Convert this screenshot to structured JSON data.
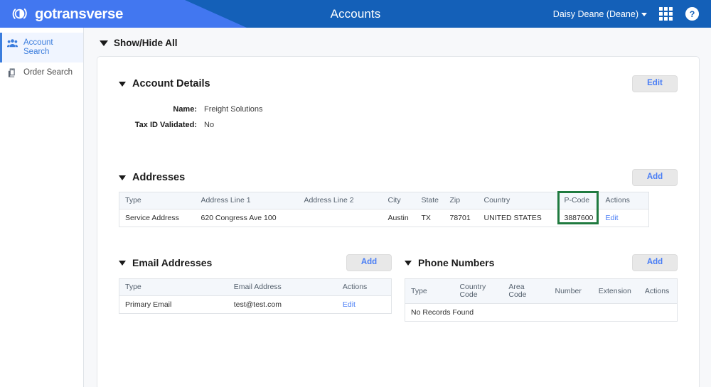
{
  "header": {
    "brand": "gotransverse",
    "brand_logo_icon": "gotransverse-circle-logo",
    "page_title": "Accounts",
    "user_menu": "Daisy Deane (Deane)",
    "apps_icon": "grid-apps-icon",
    "help_icon": "help-question-icon",
    "colors": {
      "light_blue": "#4277f0",
      "dark_blue": "#1460b8"
    }
  },
  "sidebar": {
    "items": [
      {
        "label": "Account Search",
        "icon": "people-group-icon",
        "active": true
      },
      {
        "label": "Order Search",
        "icon": "copy-documents-icon",
        "active": false
      }
    ]
  },
  "main": {
    "show_hide_all": "Show/Hide All",
    "account_details": {
      "title": "Account Details",
      "edit_label": "Edit",
      "fields": [
        {
          "label": "Name:",
          "value": "Freight Solutions"
        },
        {
          "label": "Tax ID Validated:",
          "value": "No"
        }
      ]
    },
    "addresses": {
      "title": "Addresses",
      "add_label": "Add",
      "columns": [
        "Type",
        "Address Line 1",
        "Address Line 2",
        "City",
        "State",
        "Zip",
        "Country",
        "P-Code",
        "Actions"
      ],
      "rows": [
        {
          "type": "Service Address",
          "address_line_1": "620 Congress Ave 100",
          "address_line_2": "",
          "city": "Austin",
          "state": "TX",
          "zip": "78701",
          "country": "UNITED STATES",
          "p_code": "3887600",
          "action": "Edit"
        }
      ],
      "highlight": {
        "column": "P-Code",
        "color": "#1f7a3f"
      }
    },
    "email_addresses": {
      "title": "Email Addresses",
      "add_label": "Add",
      "columns": [
        "Type",
        "Email Address",
        "Actions"
      ],
      "rows": [
        {
          "type": "Primary Email",
          "email": "test@test.com",
          "action": "Edit"
        }
      ]
    },
    "phone_numbers": {
      "title": "Phone Numbers",
      "add_label": "Add",
      "columns": [
        "Type",
        "Country Code",
        "Area Code",
        "Number",
        "Extension",
        "Actions"
      ],
      "empty_text": "No Records Found"
    }
  }
}
